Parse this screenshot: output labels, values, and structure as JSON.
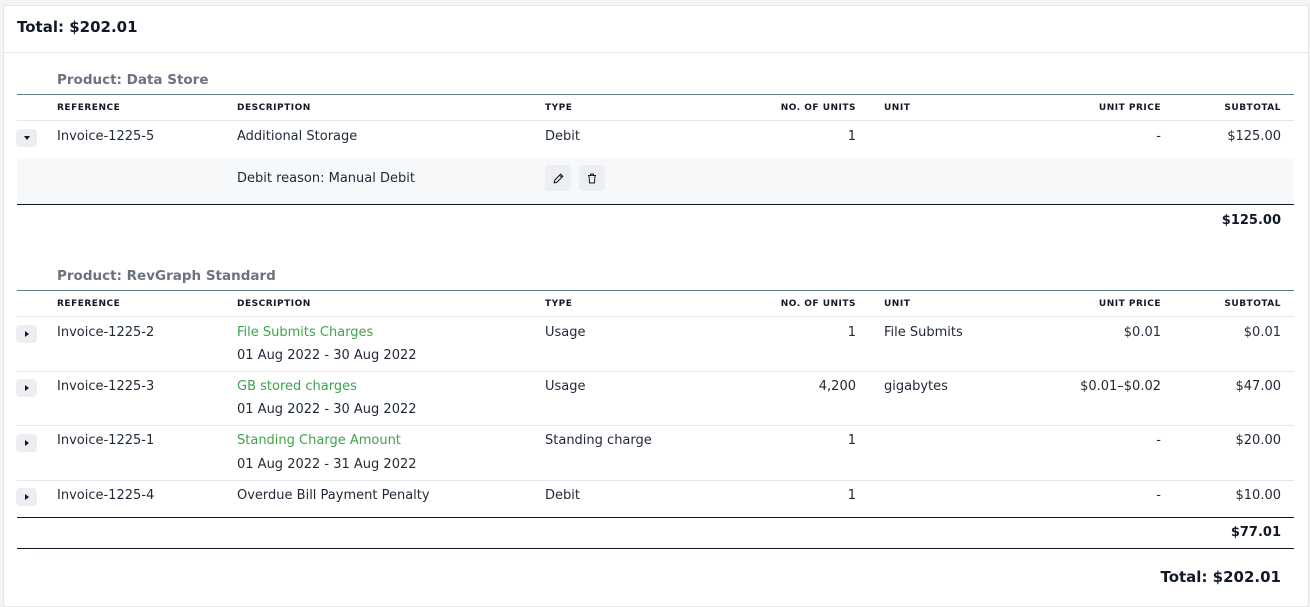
{
  "total_header": "Total: $202.01",
  "columns": {
    "reference": "REFERENCE",
    "description": "DESCRIPTION",
    "type": "TYPE",
    "units": "NO. OF UNITS",
    "unit": "UNIT",
    "unit_price": "UNIT PRICE",
    "subtotal": "SUBTOTAL"
  },
  "products": [
    {
      "title": "Product: Data Store",
      "rows": [
        {
          "reference": "Invoice-1225-5",
          "description": "Additional Storage",
          "period": "",
          "type": "Debit",
          "units": "1",
          "unit": "",
          "unit_price": "-",
          "subtotal": "$125.00",
          "expanded": true,
          "reason": "Debit reason: Manual Debit"
        }
      ],
      "total": "$125.00"
    },
    {
      "title": "Product: RevGraph Standard",
      "rows": [
        {
          "reference": "Invoice-1225-2",
          "description": "File Submits Charges",
          "period": "01 Aug 2022 - 30 Aug 2022",
          "type": "Usage",
          "units": "1",
          "unit": "File Submits",
          "unit_price": "$0.01",
          "subtotal": "$0.01",
          "link": true
        },
        {
          "reference": "Invoice-1225-3",
          "description": "GB stored charges",
          "period": "01 Aug 2022 - 30 Aug 2022",
          "type": "Usage",
          "units": "4,200",
          "unit": "gigabytes",
          "unit_price": "$0.01–$0.02",
          "subtotal": "$47.00",
          "link": true
        },
        {
          "reference": "Invoice-1225-1",
          "description": "Standing Charge Amount",
          "period": "01 Aug 2022 - 31 Aug 2022",
          "type": "Standing charge",
          "units": "1",
          "unit": "",
          "unit_price": "-",
          "subtotal": "$20.00",
          "link": true
        },
        {
          "reference": "Invoice-1225-4",
          "description": "Overdue Bill Payment Penalty",
          "period": "",
          "type": "Debit",
          "units": "1",
          "unit": "",
          "unit_price": "-",
          "subtotal": "$10.00",
          "link": false
        }
      ],
      "total": "$77.01"
    }
  ],
  "grand_total": "Total: $202.01",
  "icons": {
    "edit": "pencil-icon",
    "delete": "trash-icon"
  },
  "colors": {
    "link": "#3fa34d",
    "product_title": "#6b7280",
    "expand_bg": "#eceef1"
  }
}
